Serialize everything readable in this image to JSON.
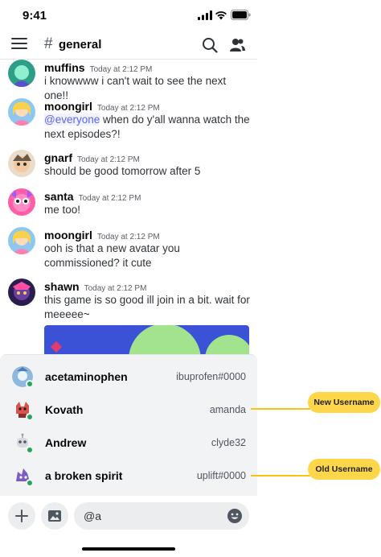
{
  "status_bar": {
    "time": "9:41"
  },
  "header": {
    "hash": "#",
    "channel_name": "general"
  },
  "messages": [
    {
      "username": "muffins",
      "timestamp": "Today at 2:12 PM",
      "text": "i knowwww i can't wait to see the next one!!",
      "avatar_color": "#2f9e87"
    },
    {
      "username": "moongirl",
      "timestamp": "Today at 2:12 PM",
      "mention": "@everyone",
      "text": " when do y'all wanna watch the next episodes?!",
      "avatar_color": "#f6a5c0"
    },
    {
      "username": "gnarf",
      "timestamp": "Today at 2:12 PM",
      "text": "should be good tomorrow after 5",
      "avatar_color": "#d9c3a6"
    },
    {
      "username": "santa",
      "timestamp": "Today at 2:12 PM",
      "text": "me too!",
      "avatar_color": "#ff5ea8"
    },
    {
      "username": "moongirl",
      "timestamp": "Today at 2:12 PM",
      "text": "ooh is that a new avatar you commissioned? it cute",
      "avatar_color": "#f6a5c0"
    },
    {
      "username": "shawn",
      "timestamp": "Today at 2:12 PM",
      "text": "this game is so good ill join in a bit. wait for meeeee~",
      "avatar_color": "#6b3fa0"
    }
  ],
  "autocomplete": [
    {
      "display_name": "acetaminophen",
      "tag": "ibuprofen#0000",
      "avatar_color": "#8fb8de"
    },
    {
      "display_name": "Kovath",
      "tag": "amanda",
      "avatar_color": "#d9534f"
    },
    {
      "display_name": "Andrew",
      "tag": "clyde32",
      "avatar_color": "#b9bcc4"
    },
    {
      "display_name": "a broken spirit",
      "tag": "uplift#0000",
      "avatar_color": "#7b5cc4"
    }
  ],
  "composer": {
    "value": "@a"
  },
  "annotations": {
    "new_username": "New Username",
    "old_username": "Old Username"
  },
  "colors": {
    "accent": "#5865f2",
    "online": "#23a55a",
    "annotation": "#fdd64a"
  }
}
